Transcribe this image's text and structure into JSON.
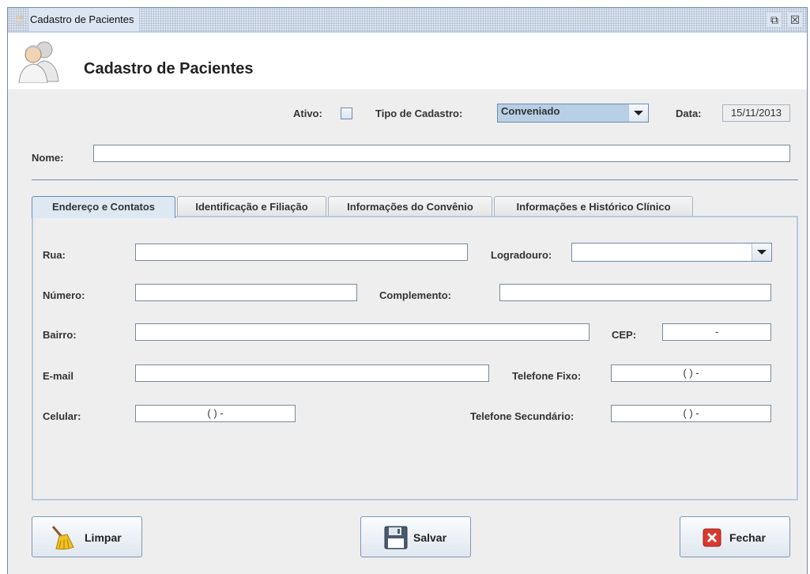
{
  "window": {
    "title": "Cadastro de Pacientes",
    "restore_glyph": "⧉",
    "close_glyph": "☒"
  },
  "header": {
    "title": "Cadastro de Pacientes",
    "icon": "patients-icon"
  },
  "top": {
    "ativo_label": "Ativo:",
    "tipo_label": "Tipo de Cadastro:",
    "tipo_value": "Conveniado",
    "data_label": "Data:",
    "data_value": "15/11/2013",
    "nome_label": "Nome:",
    "nome_value": ""
  },
  "tabs": [
    {
      "label": "Endereço e Contatos",
      "active": true
    },
    {
      "label": "Identificação e Filiação",
      "active": false
    },
    {
      "label": "Informações do Convênio",
      "active": false
    },
    {
      "label": "Informações e Histórico Clínico",
      "active": false
    }
  ],
  "address": {
    "rua_label": "Rua:",
    "logradouro_label": "Logradouro:",
    "numero_label": "Número:",
    "complemento_label": "Complemento:",
    "bairro_label": "Bairro:",
    "cep_label": "CEP:",
    "cep_mask": "-",
    "email_label": "E-mail",
    "telfixo_label": "Telefone Fixo:",
    "telfixo_mask": "(  )  -",
    "celular_label": "Celular:",
    "celular_mask": "(  )  -",
    "telsec_label": "Telefone Secundário:",
    "telsec_mask": "(  )  -"
  },
  "buttons": {
    "limpar": "Limpar",
    "salvar": "Salvar",
    "fechar": "Fechar"
  },
  "colors": {
    "accent": "#6d8cb0",
    "combo_selected": "#b8cfe5",
    "close_red": "#d83a2e"
  }
}
